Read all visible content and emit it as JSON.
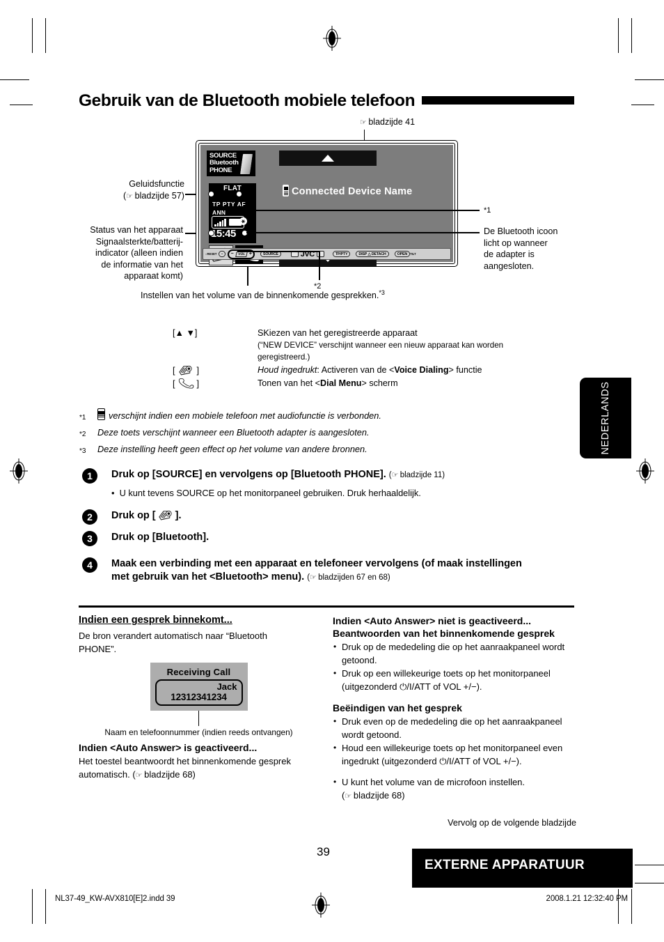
{
  "page": {
    "title": "Gebruik van de Bluetooth mobiele telefoon",
    "number": "39",
    "section_banner": "EXTERNE APPARATUUR",
    "language_tab": "NEDERLANDS",
    "footer_left": "NL37-49_KW-AVX810[E]2.indd   39",
    "footer_right": "2008.1.21   12:32:40 PM",
    "continued": "Vervolg op de volgende bladzijde"
  },
  "figure": {
    "callout_top": "bladzijde 41",
    "label_sound_mode_1": "Geluidsfunctie",
    "label_sound_mode_2": "bladzijde 57)",
    "label_status_1": "Status van het apparaat",
    "label_status_2": "Signaalsterkte/batterij-",
    "label_status_3": "indicator (alleen indien",
    "label_status_4": "de informatie van het",
    "label_status_5": "apparaat komt)",
    "star1_marker": "*1",
    "right_note_1": "De Bluetooth icoon",
    "right_note_2": "licht op wanneer",
    "right_note_3": "de adapter is",
    "right_note_4": "aangesloten.",
    "star2_marker": "*2",
    "volume_caption": "Instellen van het volume van de binnenkomende gesprekken.",
    "volume_caption_star": "*3",
    "unit": {
      "source_line1": "SOURCE",
      "source_line2": "Bluetooth",
      "source_line3": "PHONE",
      "device_name": "Connected Device Name",
      "lcd_flat": "FLAT",
      "lcd_rds": "TP  PTY  AF",
      "lcd_ann": "ANN",
      "lcd_clock": "15:45",
      "lcd_bt_icon": "bluetooth-icon",
      "panel_reset": "RESET",
      "panel_source": "SOURCE",
      "panel_brand": "JVC",
      "panel_tppty": "TP/PTY",
      "panel_disp": "DISP",
      "panel_detach": "DETACH",
      "panel_open": "OPEN",
      "panel_vol": "VOL"
    }
  },
  "keys": [
    {
      "key": "[▲ ▼]",
      "key_icon": "",
      "desc_lines": [
        "SKiezen van het geregistreerde apparaat",
        "(“NEW DEVICE” verschijnt wanneer een nieuw apparaat kan worden",
        "geregistreerd.)"
      ]
    },
    {
      "key": "[ ]",
      "key_icon": "voice-dialing-icon",
      "desc_prefix": "Houd ingedrukt",
      "desc_mid": ": Activeren van de <",
      "desc_bold": "Voice Dialing",
      "desc_suffix": "> functie"
    },
    {
      "key": "[ ]",
      "key_icon": "phone-hook-icon",
      "desc_mid": "Tonen van het <",
      "desc_bold": "Dial Menu",
      "desc_suffix": "> scherm"
    }
  ],
  "footnotes": [
    {
      "mark": "*1",
      "text": "verschijnt indien een mobiele telefoon met audiofunctie is verbonden.",
      "has_icon": true
    },
    {
      "mark": "*2",
      "text": "Deze toets verschijnt wanneer een Bluetooth adapter is aangesloten.",
      "has_icon": false
    },
    {
      "mark": "*3",
      "text": "Deze instelling heeft geen effect op het volume van andere bronnen.",
      "has_icon": false
    }
  ],
  "steps": {
    "s1_num": "1",
    "s1_text": "Druk op [SOURCE] en vervolgens op [Bluetooth PHONE].",
    "s1_ref": "bladzijde 11)",
    "s1_bullet": "U kunt tevens SOURCE op het monitorpaneel gebruiken. Druk herhaaldelijk.",
    "s2_num": "2",
    "s2_text_a": "Druk op [",
    "s2_text_b": "].",
    "s3_num": "3",
    "s3_text": "Druk op [Bluetooth].",
    "s4_num": "4",
    "s4_text_l1": "Maak een verbinding met een apparaat en telefoneer vervolgens (of maak instellingen",
    "s4_text_l2": "met gebruik van het <Bluetooth> menu).",
    "s4_ref": "bladzijden 67 en 68)"
  },
  "left_column": {
    "heading": "Indien een gesprek binnekomt...",
    "para_l1": "De bron verandert automatisch naar “Bluetooth",
    "para_l2": "PHONE”.",
    "receiving": {
      "title": "Receiving Call",
      "name": "Jack",
      "number": "12312341234"
    },
    "caption": "Naam en telefoonnummer (indien reeds ontvangen)",
    "subheading": "Indien <Auto Answer> is geactiveerd...",
    "sub_para_l1": "Het toestel beantwoordt het binnenkomende gesprek",
    "sub_para_l2": "automatisch. (",
    "sub_para_ref": "bladzijde 68)"
  },
  "right_column": {
    "heading_l1": "Indien <Auto Answer> niet is geactiveerd...",
    "heading_l2": "Beantwoorden van het binnenkomende gesprek",
    "bullets": [
      "Druk op de mededeling die op het aanraakpaneel wordt getoond.",
      "Druk op een willekeurige toets op het monitorpaneel (uitgezonderd ⏻/I/ATT of VOL +/−)."
    ],
    "heading2": "Beëindigen van het gesprek",
    "bullets2": [
      "Druk even op de mededeling die op het aanraakpaneel wordt getoond.",
      "Houd een willekeurige toets op het monitorpaneel even ingedrukt (uitgezonderd ⏻/I/ATT of VOL +/−)."
    ],
    "bullet3_l1": "U kunt het volume van de microfoon instellen.",
    "bullet3_l2": "bladzijde 68)"
  }
}
